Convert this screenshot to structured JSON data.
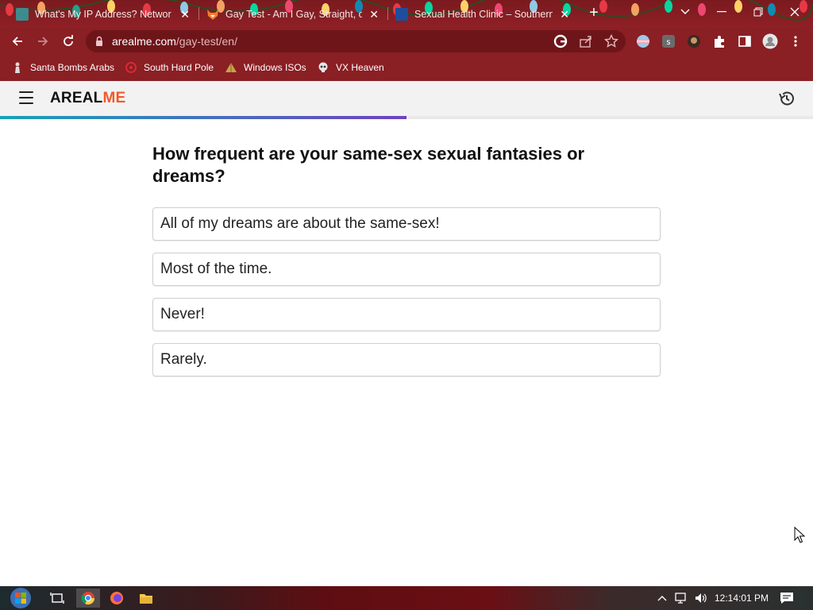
{
  "browser": {
    "tabs": [
      {
        "title": "What's My IP Address? Networ",
        "active": false
      },
      {
        "title": "Gay Test - Am I Gay, Straight, or",
        "active": true
      },
      {
        "title": "Sexual Health Clinic – Southern",
        "active": false
      }
    ],
    "url_host": "arealme.com",
    "url_path": "/gay-test/en/",
    "bookmarks": [
      {
        "label": "Santa Bombs Arabs"
      },
      {
        "label": "South Hard Pole"
      },
      {
        "label": "Windows ISOs"
      },
      {
        "label": "VX Heaven"
      }
    ]
  },
  "site": {
    "logo_part1": "AREAL",
    "logo_part2": "ME",
    "progress": 0.5
  },
  "quiz": {
    "question": "How frequent are your same-sex sexual fantasies or dreams?",
    "answers": [
      "All of my dreams are about the same-sex!",
      "Most of the time.",
      "Never!",
      "Rarely."
    ]
  },
  "taskbar": {
    "clock": "12:14:01 PM"
  },
  "colors": {
    "chrome_theme": "#8a1f24",
    "logo_accent": "#f1592a"
  }
}
